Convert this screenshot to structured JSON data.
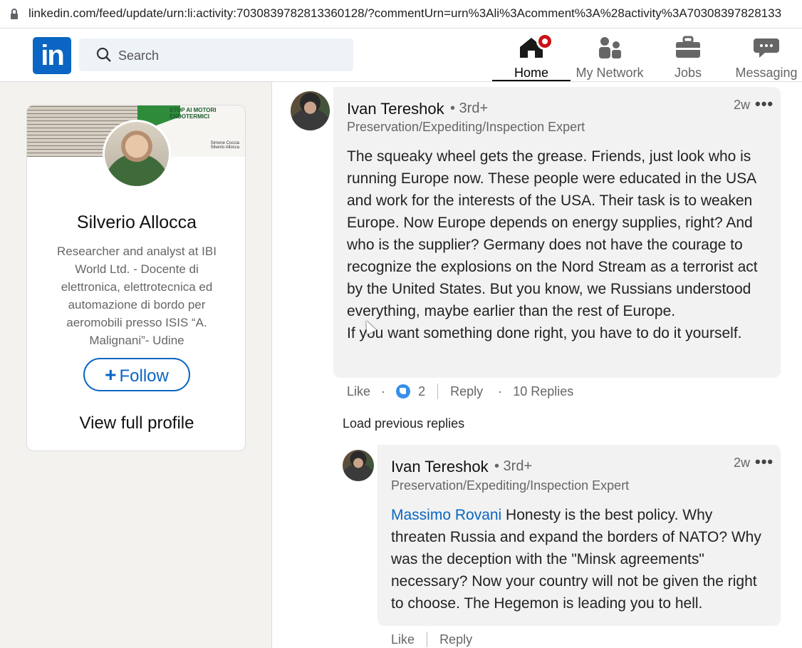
{
  "browser": {
    "url": "linkedin.com/feed/update/urn:li:activity:7030839782813360128/?commentUrn=urn%3Ali%3Acomment%3A%28activity%3A70308397828133"
  },
  "nav": {
    "logo_text": "in",
    "search_placeholder": "Search",
    "items": [
      {
        "label": "Home"
      },
      {
        "label": "My Network"
      },
      {
        "label": "Jobs"
      },
      {
        "label": "Messaging"
      }
    ]
  },
  "profile": {
    "banner_text": "STOP AI MOTORI ENDOTERMICI",
    "banner_names": "Simone Coccia\nSilverio Allocca",
    "name": "Silverio Allocca",
    "description": "Researcher and analyst at IBI World Ltd. - Docente di elettronica, elettrotecnica ed automazione di bordo per aeromobili presso ISIS “A. Malignani”- Udine",
    "follow_label": "Follow",
    "view_full_label": "View full profile"
  },
  "comment": {
    "author": "Ivan Tereshok",
    "degree": "• 3rd+",
    "headline": "Preservation/Expediting/Inspection Expert",
    "time": "2w",
    "text": "The squeaky wheel gets the grease. Friends, just look who is running Europe now. These people were educated in the USA and work for the interests of the USA. Their task is to weaken Europe. Now Europe depends on energy supplies, right? And who is the supplier? Germany does not have the courage to recognize the explosions on the Nord Stream as a terrorist act by the United States. But you know, we Russians understood everything, maybe earlier than the rest of Europe.\nIf you want something done right, you have to do it yourself.",
    "like_label": "Like",
    "like_count": "2",
    "reply_label": "Reply",
    "replies_label": "10 Replies"
  },
  "load_previous_label": "Load previous replies",
  "reply": {
    "author": "Ivan Tereshok",
    "degree": "• 3rd+",
    "headline": "Preservation/Expediting/Inspection Expert",
    "time": "2w",
    "mention": "Massimo Rovani",
    "text": " Honesty is the best policy. Why threaten Russia and expand the borders of NATO? Why was the deception with the \"Minsk agreements\" necessary? Now your country will not be given the right to choose. The Hegemon is leading you to hell.",
    "like_label": "Like",
    "reply_label": "Reply"
  },
  "colors": {
    "brand": "#0a66c2",
    "notification": "#cc1016",
    "bubble": "#f2f2f2"
  }
}
